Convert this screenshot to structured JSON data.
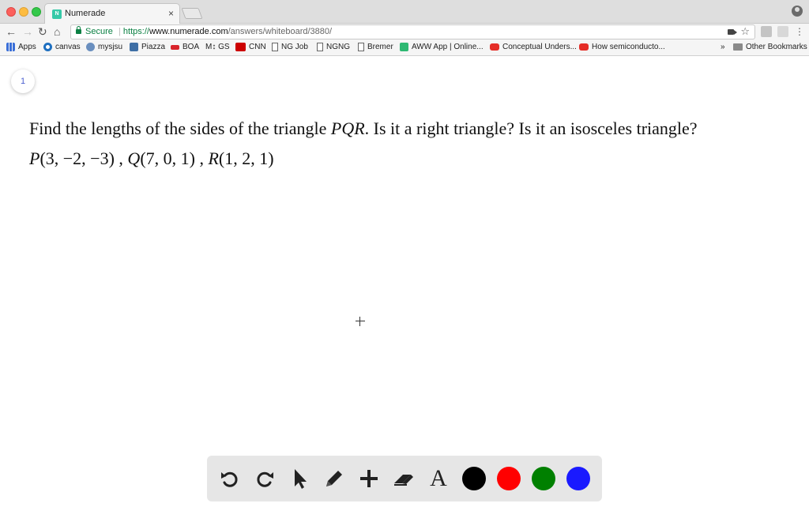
{
  "browser": {
    "tab_title": "Numerade",
    "tab_favicon": "N",
    "close_glyph": "×",
    "secure_label": "Secure",
    "url_scheme": "https://",
    "url_host": "www.numerade.com",
    "url_path": "/answers/whiteboard/3880/",
    "nav": {
      "back": "←",
      "forward": "→",
      "reload": "↻",
      "home": "⌂"
    },
    "star_glyph": "☆"
  },
  "bookmarks": {
    "items": [
      {
        "label": "Apps",
        "icon": "apps-icon"
      },
      {
        "label": "canvas",
        "icon": "canvas-icon"
      },
      {
        "label": "mysjsu",
        "icon": "mysjsu-icon"
      },
      {
        "label": "Piazza",
        "icon": "piazza-icon"
      },
      {
        "label": "BOA",
        "icon": "boa-icon"
      },
      {
        "label": "M↕ GS",
        "icon": "gs-icon"
      },
      {
        "label": "CNN",
        "icon": "cnn-icon"
      },
      {
        "label": "NG Job",
        "icon": "page-icon"
      },
      {
        "label": "NGNG",
        "icon": "page-icon"
      },
      {
        "label": "Bremer",
        "icon": "page-icon"
      },
      {
        "label": "AWW App | Online...",
        "icon": "aww-icon"
      },
      {
        "label": "Conceptual Unders...",
        "icon": "youtube-icon"
      },
      {
        "label": "How semiconducto...",
        "icon": "youtube-icon"
      }
    ],
    "overflow": "»",
    "other": "Other Bookmarks"
  },
  "whiteboard": {
    "page_number": "1",
    "question_parts": [
      "Find the lengths of the sides of the triangle ",
      "PQR",
      ". Is it a right triangle? Is it an isosceles triangle?"
    ],
    "points": [
      {
        "name": "P",
        "coords": "(3, −2, −3)"
      },
      {
        "name": "Q",
        "coords": "(7, 0, 1)"
      },
      {
        "name": "R",
        "coords": "(1, 2, 1)"
      }
    ],
    "separator": " , "
  },
  "drawing_toolbar": {
    "tools": [
      "undo-icon",
      "redo-icon",
      "select-arrow-icon",
      "pencil-icon",
      "add-plus-icon",
      "eraser-icon",
      "text-tool-icon"
    ],
    "text_tool_glyph": "A",
    "colors": [
      "#000000",
      "#ff0000",
      "#008000",
      "#1a1aff"
    ]
  }
}
